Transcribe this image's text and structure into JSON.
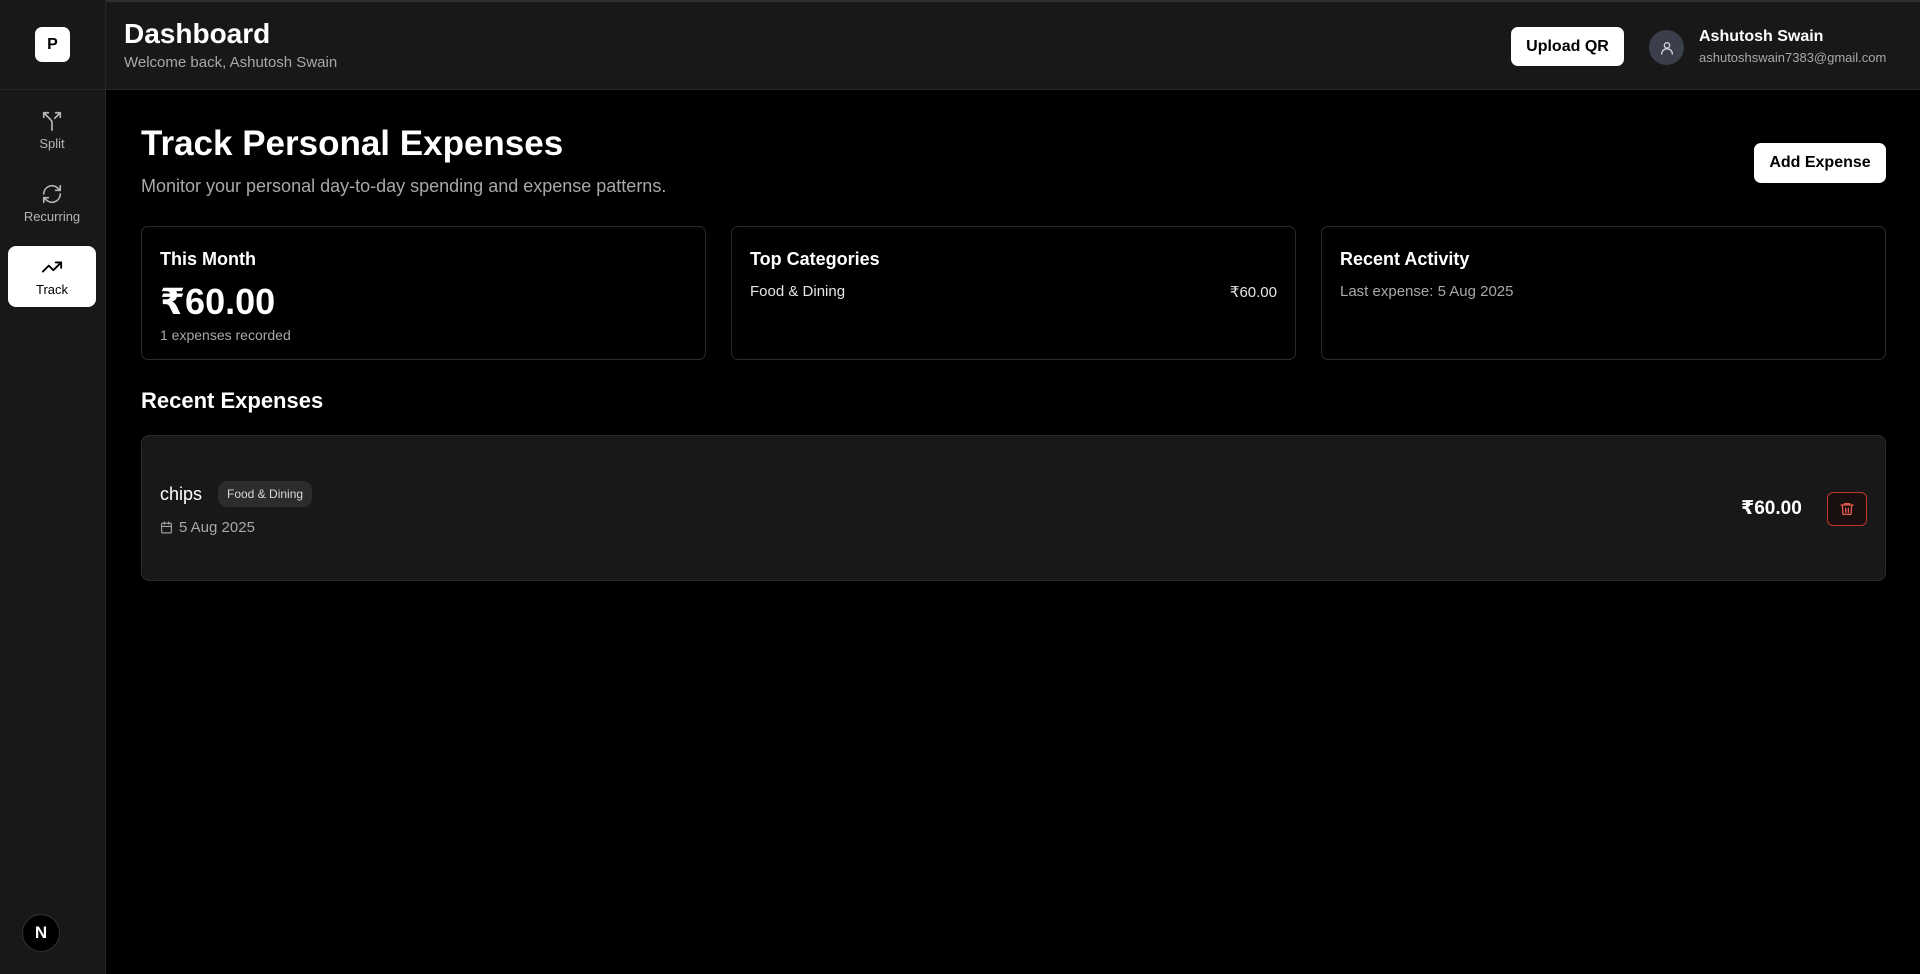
{
  "sidebar": {
    "logo": "P",
    "items": [
      {
        "label": "Split"
      },
      {
        "label": "Recurring"
      },
      {
        "label": "Track"
      }
    ],
    "footer_badge": "N"
  },
  "header": {
    "title": "Dashboard",
    "subtitle": "Welcome back, Ashutosh Swain",
    "upload_label": "Upload QR",
    "user": {
      "name": "Ashutosh Swain",
      "email": "ashutoshswain7383@gmail.com"
    }
  },
  "main": {
    "title": "Track Personal Expenses",
    "subtitle": "Monitor your personal day-to-day spending and expense patterns.",
    "add_label": "Add Expense",
    "cards": {
      "this_month": {
        "title": "This Month",
        "amount": "₹60.00",
        "sub": "1 expenses recorded"
      },
      "top_categories": {
        "title": "Top Categories",
        "category": "Food & Dining",
        "amount": "₹60.00"
      },
      "recent_activity": {
        "title": "Recent Activity",
        "text": "Last expense: 5 Aug 2025"
      }
    },
    "recent_title": "Recent Expenses",
    "expenses": [
      {
        "name": "chips",
        "category": "Food & Dining",
        "date": "5 Aug 2025",
        "amount": "₹60.00"
      }
    ]
  },
  "colors": {
    "background": "#000000",
    "panel": "#181818",
    "danger": "#c0392b"
  }
}
